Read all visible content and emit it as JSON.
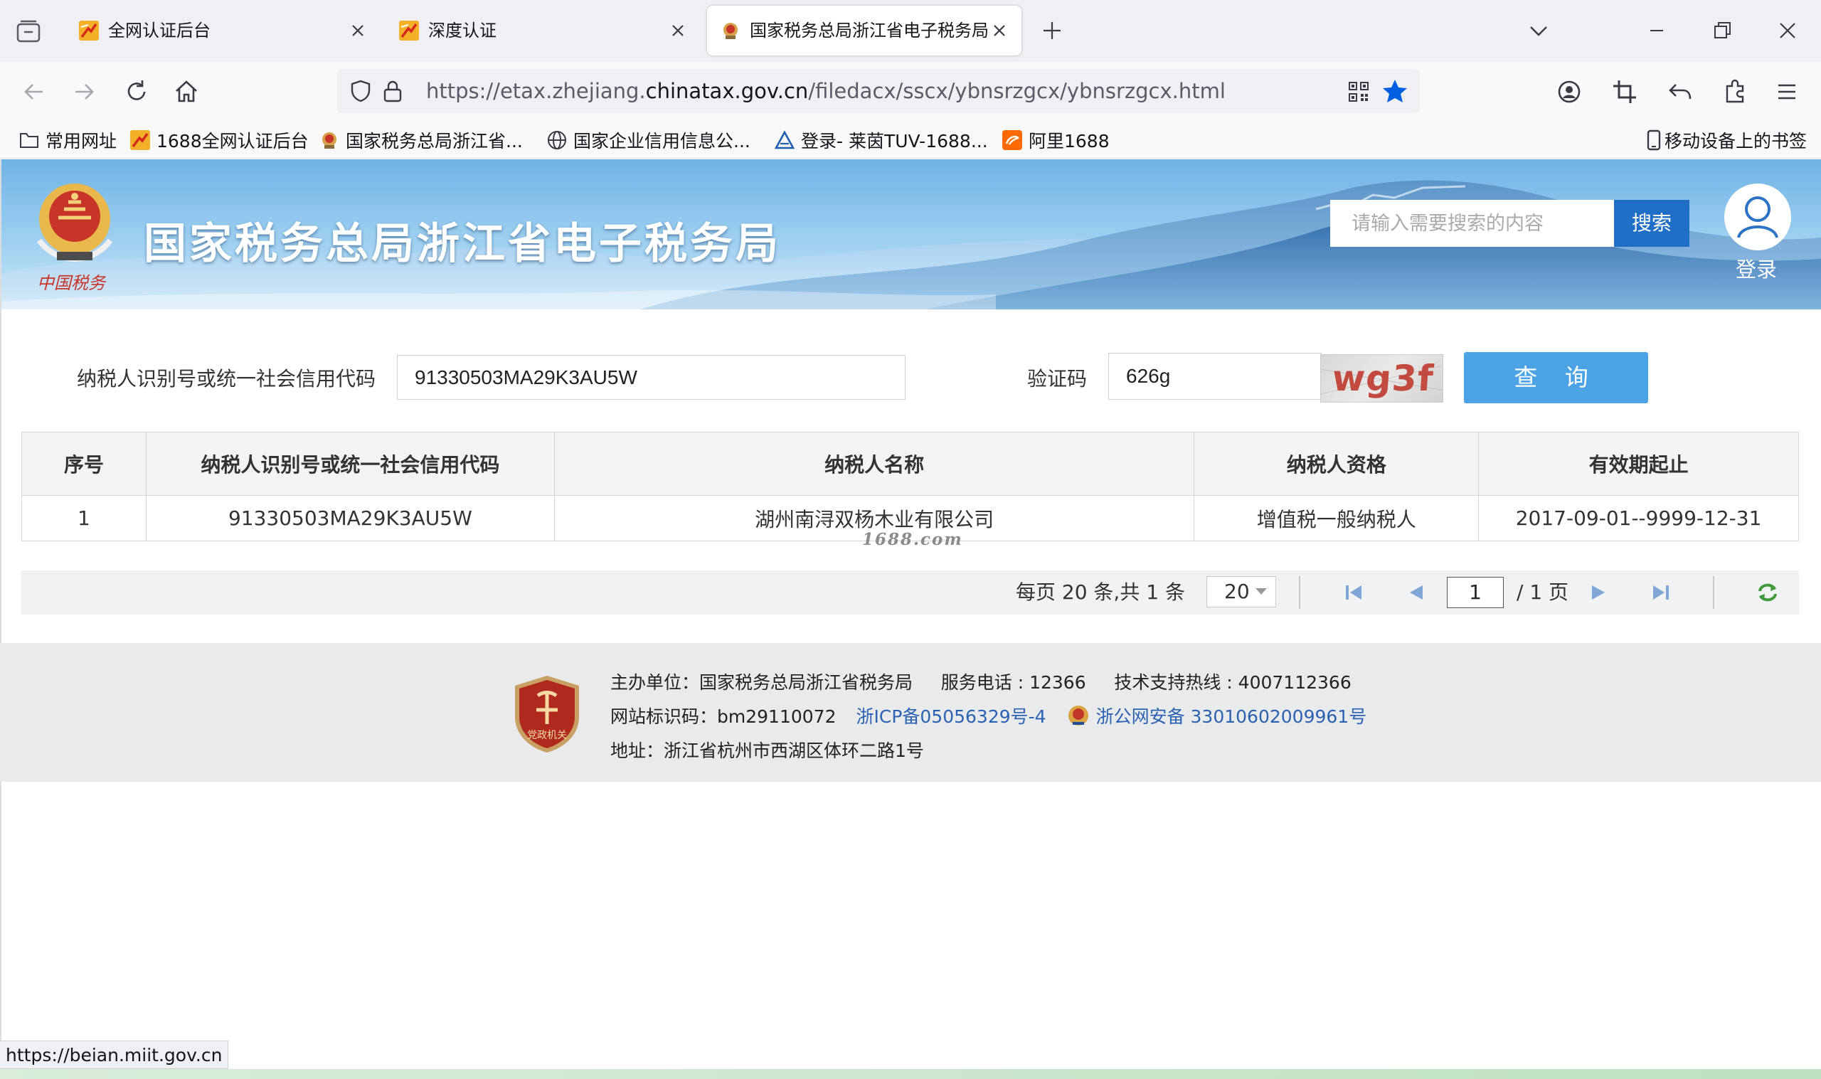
{
  "browser": {
    "tabs": [
      {
        "title": "全网认证后台",
        "favicon": "rocket-favicon-icon",
        "active": false
      },
      {
        "title": "深度认证",
        "favicon": "rocket-favicon-icon",
        "active": false
      },
      {
        "title": "国家税务总局浙江省电子税务局",
        "favicon": "tax-emblem-favicon-icon",
        "active": true
      }
    ],
    "url_prefix": "https://etax.zhejiang.",
    "url_domain": "chinatax.gov.cn",
    "url_suffix": "/filedacx/sscx/ybnsrzgcx/ybnsrzgcx.html",
    "bookmarks": [
      {
        "label": "常用网址",
        "icon": "folder-icon"
      },
      {
        "label": "1688全网认证后台",
        "icon": "rocket-favicon-icon"
      },
      {
        "label": "国家税务总局浙江省...",
        "icon": "tax-emblem-favicon-icon"
      },
      {
        "label": "国家企业信用信息公...",
        "icon": "globe-icon"
      },
      {
        "label": "登录- 莱茵TUV-1688...",
        "icon": "tuv-triangle-icon"
      },
      {
        "label": "阿里1688",
        "icon": "ali1688-icon"
      }
    ],
    "mobile_bookmarks": "移动设备上的书签",
    "accent_color": "#0060df"
  },
  "header": {
    "site_title": "国家税务总局浙江省电子税务局",
    "search_placeholder": "请输入需要搜索的内容",
    "search_button": "搜索",
    "login_label": "登录",
    "search_button_color": "#1f6fc7"
  },
  "query_form": {
    "taxpayer_label": "纳税人识别号或统一社会信用代码",
    "taxpayer_value": "91330503MA29K3AU5W",
    "captcha_label": "验证码",
    "captcha_value": "626g",
    "captcha_image_text": "wg3f",
    "query_button": "查 询",
    "query_button_color": "#4ba3e6"
  },
  "results": {
    "headers": [
      "序号",
      "纳税人识别号或统一社会信用代码",
      "纳税人名称",
      "纳税人资格",
      "有效期起止"
    ],
    "rows": [
      [
        "1",
        "91330503MA29K3AU5W",
        "湖州南浔双杨木业有限公司",
        "增值税一般纳税人",
        "2017-09-01--9999-12-31"
      ]
    ],
    "watermark": "1688.com"
  },
  "pagination": {
    "summary": "每页 20 条,共 1 条",
    "page_size": "20",
    "current_page": "1",
    "total_pages": "/ 1 页"
  },
  "footer": {
    "host_unit": "主办单位：国家税务总局浙江省税务局",
    "service_phone": "服务电话 : 12366",
    "support_hotline": "技术支持热线 : 4007112366",
    "site_id": "网站标识码：bm29110072",
    "icp": "浙ICP备05056329号-4",
    "police_record": "浙公网安备 33010602009961号",
    "address": "地址：浙江省杭州市西湖区体环二路1号",
    "badge_text": "党政机关"
  },
  "status_bar": {
    "hover_url": "https://beian.miit.gov.cn"
  }
}
